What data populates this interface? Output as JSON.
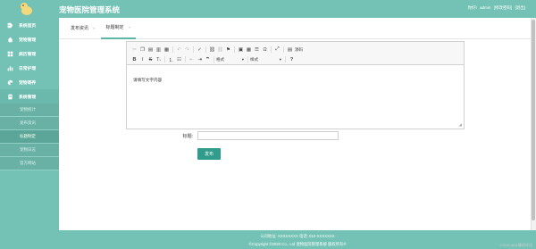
{
  "header": {
    "app_title": "宠物医院管理系统",
    "welcome": "你好!",
    "user": "admin",
    "change_password": "[修改密码]",
    "logout": "[退出]"
  },
  "sidebar": {
    "items": [
      {
        "label": "系统首页",
        "icon": "tag-icon"
      },
      {
        "label": "宠物管理",
        "icon": "house-icon"
      },
      {
        "label": "病历管理",
        "icon": "grid-icon"
      },
      {
        "label": "日常护理",
        "icon": "bars-icon"
      },
      {
        "label": "宠物寄养",
        "icon": "fan-icon"
      },
      {
        "label": "系统管理",
        "icon": "document-icon"
      }
    ],
    "submenu": [
      "宠物统计",
      "发布资讯",
      "标题制定",
      "宠物日志",
      "官方网站"
    ]
  },
  "tabs": [
    {
      "label": "发布资讯",
      "arrow": "»"
    },
    {
      "label": "标题制定",
      "arrow": "»"
    }
  ],
  "editor": {
    "placeholder_text": "请填写文字内容",
    "format_select": "格式",
    "style_select": "样式",
    "source_label": "源码",
    "bold": "B",
    "italic": "I",
    "strike": "S",
    "help": "?"
  },
  "form": {
    "title_label": "标题:",
    "title_value": "",
    "publish_label": "发布"
  },
  "footer": {
    "line1": "公司地址: XXXXXXXX 电话: 010-XXXXXXX",
    "line2": "©Copyright ©2020 Co., Ltd 宠物医院管理系统 版权所有®"
  },
  "watermark": "CSDN @计算机毕设"
}
